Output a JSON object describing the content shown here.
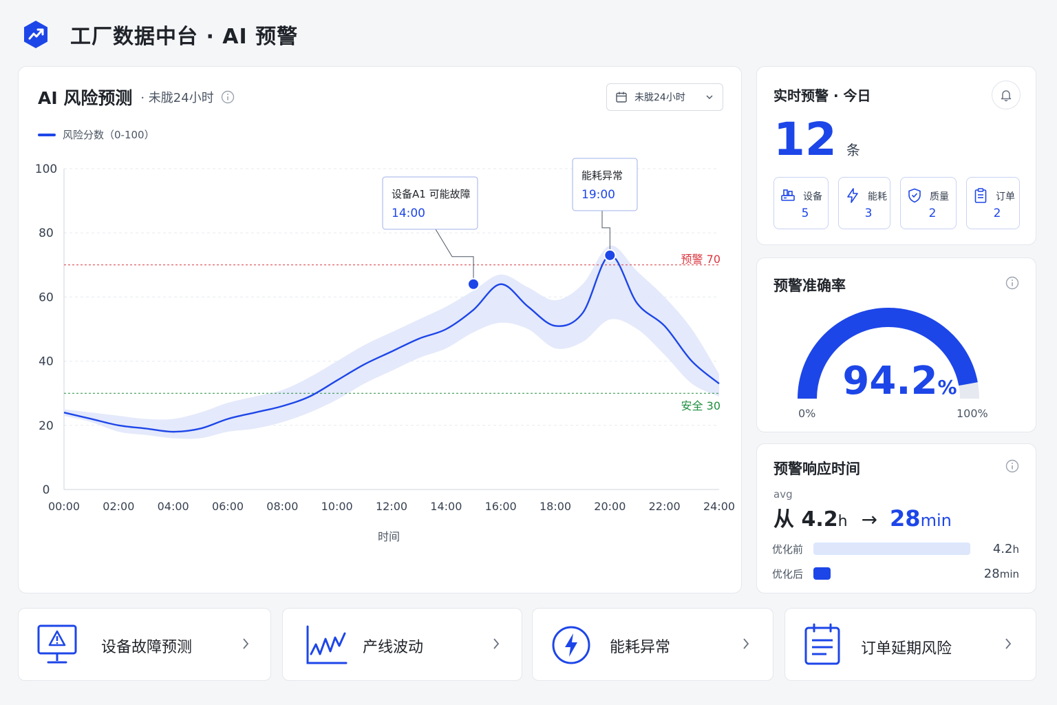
{
  "app": {
    "title": "工厂数据中台 · AI 预警"
  },
  "risk_panel": {
    "title": "AI 风险预测",
    "subtitle": "· 未胧24小时",
    "range_select": "未胧24小时",
    "legend": "风险分数（0-100）",
    "xlabel": "时间",
    "thresholds": {
      "warning": {
        "label": "预警 70",
        "value": 70,
        "color": "#d9363e"
      },
      "safe": {
        "label": "安全 30",
        "value": 30,
        "color": "#1e8e3e"
      }
    },
    "callouts": [
      {
        "title": "设备A1 可能故障",
        "time": "14:00"
      },
      {
        "title": "能耗异常",
        "time": "19:00"
      }
    ]
  },
  "chart_data": {
    "type": "line",
    "xlabel": "时间",
    "ylabel": "",
    "ylim": [
      0,
      100
    ],
    "y_ticks": [
      0,
      20,
      40,
      60,
      80,
      100
    ],
    "x_ticks": [
      "00:00",
      "02:00",
      "04:00",
      "06:00",
      "08:00",
      "10:00",
      "12:00",
      "14:00",
      "16:00",
      "18:00",
      "20:00",
      "22:00",
      "24:00"
    ],
    "grid": true,
    "legend_position": "top-left",
    "series": [
      {
        "name": "风险分数（0-100）",
        "color": "#1d46e8",
        "x": [
          0,
          1,
          2,
          3,
          4,
          5,
          6,
          7,
          8,
          9,
          10,
          11,
          12,
          13,
          14,
          15,
          16,
          17,
          18,
          19,
          20,
          21,
          22,
          23,
          24
        ],
        "values": [
          24,
          22,
          20,
          19,
          18,
          19,
          22,
          24,
          26,
          29,
          34,
          39,
          43,
          47,
          50,
          56,
          64,
          57,
          51,
          55,
          73,
          58,
          51,
          40,
          33
        ],
        "band_upper": [
          25,
          24,
          23,
          22,
          22,
          24,
          27,
          29,
          31,
          35,
          40,
          45,
          49,
          53,
          57,
          62,
          67,
          63,
          59,
          64,
          76,
          68,
          60,
          50,
          36
        ],
        "band_lower": [
          23,
          21,
          18,
          17,
          16,
          16,
          18,
          19,
          21,
          24,
          28,
          33,
          37,
          41,
          44,
          49,
          52,
          50,
          44,
          46,
          53,
          50,
          42,
          33,
          29
        ]
      }
    ],
    "highlight_points": [
      {
        "x": 15,
        "y": 64,
        "label": "设备A1 可能故障",
        "time": "14:00"
      },
      {
        "x": 20,
        "y": 73,
        "label": "能耗异常",
        "time": "19:00"
      }
    ]
  },
  "alerts": {
    "title": "实时预警 · 今日",
    "count": "12",
    "unit": "条",
    "categories": [
      {
        "label": "设备",
        "value": "5",
        "icon": "equipment-icon"
      },
      {
        "label": "能耗",
        "value": "3",
        "icon": "lightning-icon"
      },
      {
        "label": "质量",
        "value": "2",
        "icon": "shield-check-icon"
      },
      {
        "label": "订单",
        "value": "2",
        "icon": "clipboard-icon"
      }
    ]
  },
  "accuracy": {
    "title": "预警准确率",
    "value": 94.2,
    "value_text": "94.2",
    "unit": "%",
    "min_label": "0%",
    "max_label": "100%",
    "color": "#1d46e8"
  },
  "response": {
    "title": "预警响应时间",
    "avg_label": "avg",
    "from_prefix": "从",
    "from_value": "4.2",
    "from_unit": "h",
    "arrow": "→",
    "to_value": "28",
    "to_unit": "min",
    "bars": [
      {
        "label": "优化前",
        "value_text": "4.2",
        "unit": "h",
        "minutes": 252,
        "color": "#dde6fb"
      },
      {
        "label": "优化后",
        "value_text": "28",
        "unit": "min",
        "minutes": 28,
        "color": "#1d46e8"
      }
    ]
  },
  "nav": [
    {
      "label": "设备故障预测",
      "icon": "monitor-warning-icon"
    },
    {
      "label": "产线波动",
      "icon": "line-chart-icon"
    },
    {
      "label": "能耗异常",
      "icon": "lightning-circle-icon"
    },
    {
      "label": "订单延期风险",
      "icon": "clipboard-list-icon"
    }
  ]
}
